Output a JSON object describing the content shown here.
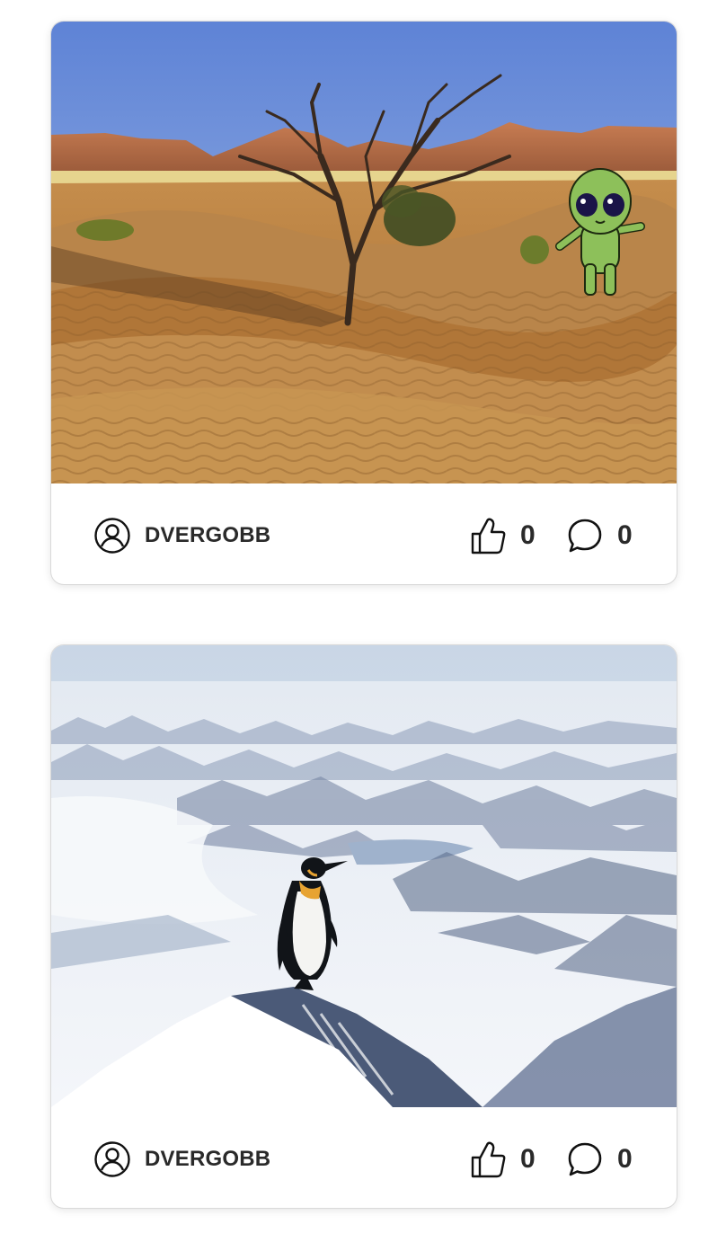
{
  "posts": [
    {
      "scene": "desert",
      "username": "DVERGOBB",
      "likes": "0",
      "comments": "0"
    },
    {
      "scene": "arctic",
      "username": "DVERGOBB",
      "likes": "0",
      "comments": "0"
    }
  ],
  "icons": {
    "user": "user-circle-icon",
    "like": "thumbs-up-icon",
    "comment": "speech-bubble-icon"
  },
  "colors": {
    "text": "#2a2a2a",
    "card_border": "#d9d9d9"
  }
}
